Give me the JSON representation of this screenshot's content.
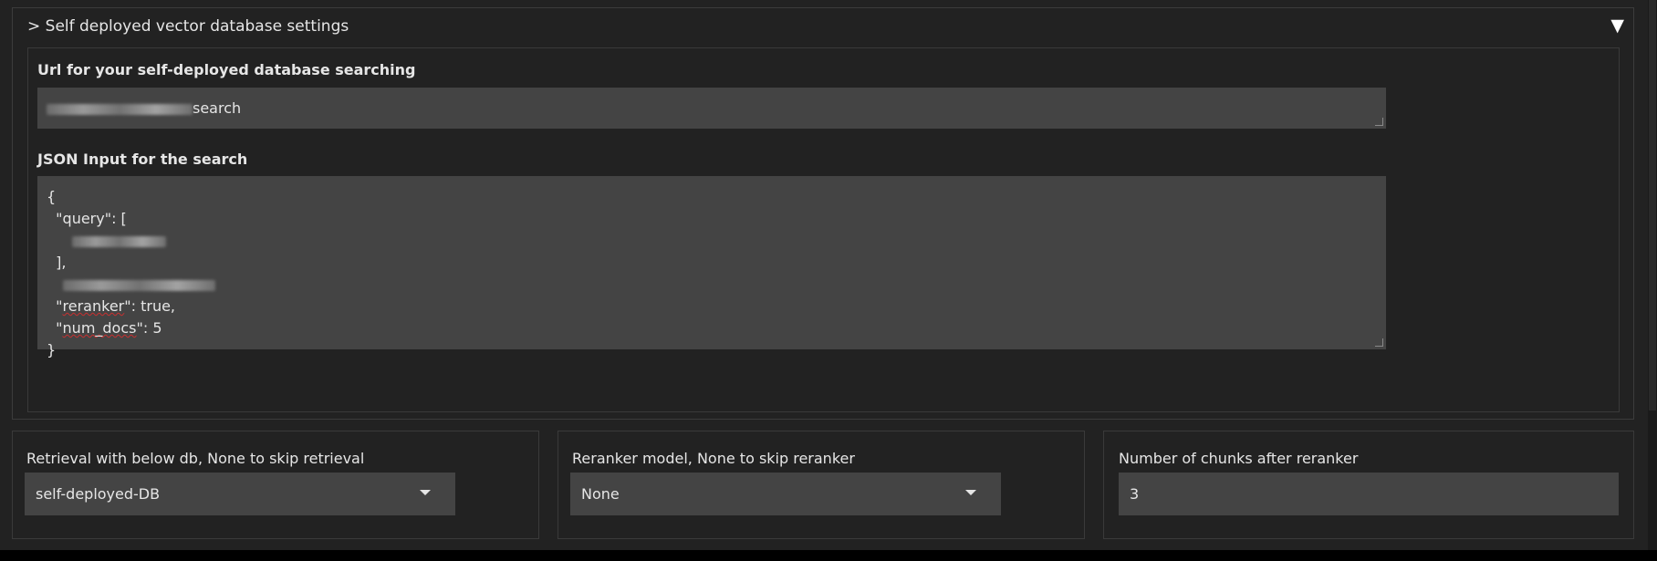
{
  "accordion": {
    "title": "> Self deployed vector database settings",
    "toggle_icon": "▼",
    "url_field": {
      "label": "Url for your self-deployed database searching",
      "value_suffix": "search"
    },
    "json_field": {
      "label": "JSON Input for the search",
      "lines": {
        "open_brace": "{",
        "query_key": "  \"query\": [",
        "close_bracket": "  ],",
        "reranker_key": "reranker",
        "reranker_value": ": true,",
        "num_docs_key": "num_docs",
        "num_docs_value": ": 5",
        "close_brace": "}"
      }
    }
  },
  "controls": {
    "retrieval": {
      "label": "Retrieval with below db, None to skip retrieval",
      "value": "self-deployed-DB"
    },
    "reranker": {
      "label": "Reranker model, None to skip reranker",
      "value": "None"
    },
    "chunks": {
      "label": "Number of chunks after reranker",
      "value": "3"
    }
  },
  "colors": {
    "background": "#222222",
    "field": "#444444",
    "text": "#e6e6e6"
  }
}
